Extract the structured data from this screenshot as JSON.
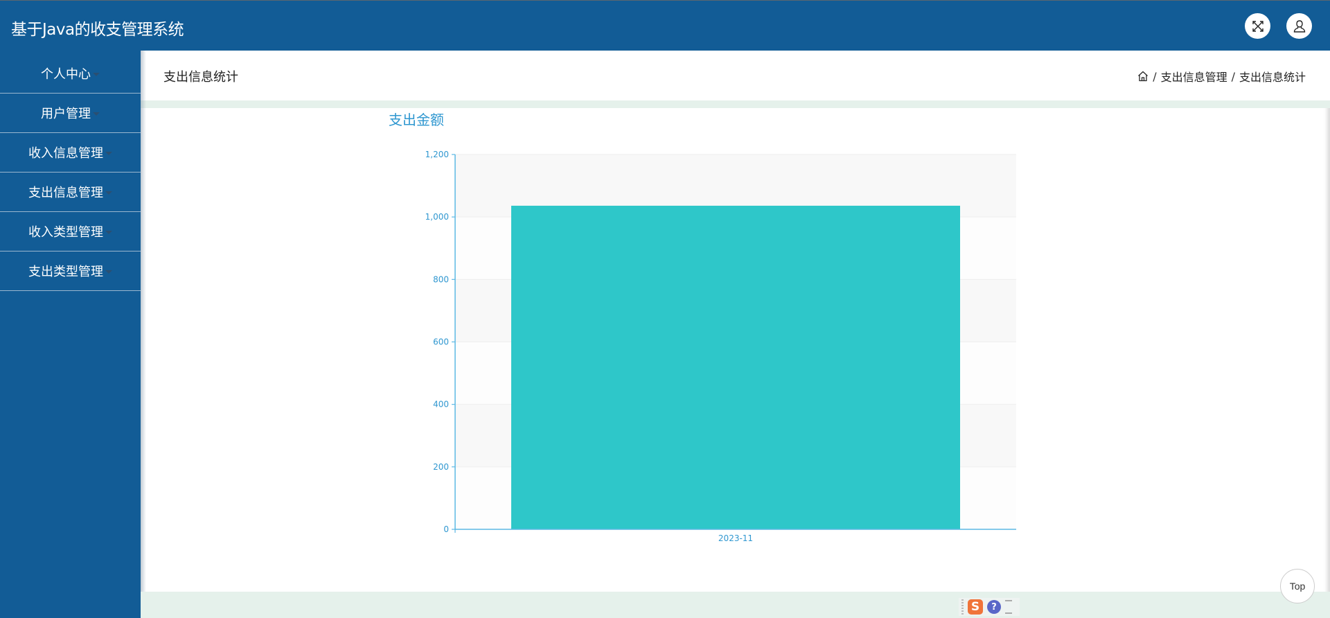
{
  "header": {
    "title": "基于Java的收支管理系统",
    "fullscreen_icon": "expand-arrows-icon",
    "user_icon": "user-icon"
  },
  "sidebar": {
    "items": [
      {
        "label": "个人中心",
        "icon": "caret-down-icon"
      },
      {
        "label": "用户管理",
        "icon": "caret-down-icon"
      },
      {
        "label": "收入信息管理",
        "icon": "caret-down-icon"
      },
      {
        "label": "支出信息管理",
        "icon": "caret-down-icon"
      },
      {
        "label": "收入类型管理",
        "icon": "caret-down-icon"
      },
      {
        "label": "支出类型管理",
        "icon": "caret-down-icon"
      }
    ]
  },
  "page": {
    "title": "支出信息统计",
    "breadcrumb": {
      "home_icon": "home-icon",
      "separator": "/",
      "items": [
        "支出信息管理",
        "支出信息统计"
      ]
    }
  },
  "colors": {
    "header_bg": "#125c96",
    "sidebar_bg": "#125c96",
    "accent_text": "#2f97d0",
    "bar": "#2ec7c9",
    "axis": "#5bb8e4",
    "band": "#f8f8f8",
    "strip": "#e5f1eb"
  },
  "chart_data": {
    "type": "bar",
    "title": "支出金额",
    "categories": [
      "2023-11"
    ],
    "values": [
      1036
    ],
    "xlabel": "",
    "ylabel": "",
    "ylim": [
      0,
      1200
    ],
    "yticks": [
      0,
      200,
      400,
      600,
      800,
      1000,
      1200
    ],
    "ytick_labels": [
      "0",
      "200",
      "400",
      "600",
      "800",
      "1,000",
      "1,200"
    ],
    "grid": true,
    "split_area": true,
    "legend": "none"
  },
  "controls": {
    "top_button": "Top"
  },
  "tray": {
    "ime_label": "S",
    "help_label": "?"
  }
}
